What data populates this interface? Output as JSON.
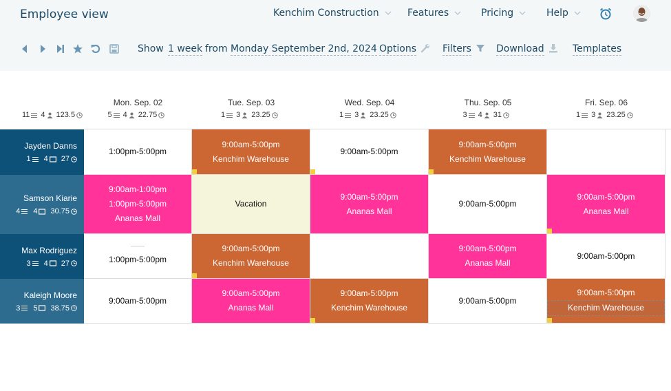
{
  "header": {
    "title": "Employee view",
    "nav": [
      {
        "label": "Kenchim Construction"
      },
      {
        "label": "Features"
      },
      {
        "label": "Pricing"
      },
      {
        "label": "Help"
      }
    ]
  },
  "toolbar": {
    "icons": [
      "previous-icon",
      "next-icon",
      "skip-to-end-icon",
      "star-icon",
      "undo-icon",
      "save-icon"
    ],
    "show_label": "Show",
    "period": "1 week",
    "from_label": "from",
    "start_date": "Monday September 2nd, 2024",
    "options": "Options",
    "filters": "Filters",
    "download": "Download",
    "templates": "Templates"
  },
  "colors": {
    "shift_orange": "#cc6633",
    "shift_pink": "#ff3399",
    "vacation": "#f5f5dc",
    "employee_dark": "#0d5078",
    "employee_light": "#2e6c8f",
    "marker": "#f2d03b"
  },
  "totals": {
    "shifts": "11",
    "employees": "4",
    "hours": "123.5"
  },
  "days": [
    {
      "label": "Mon. Sep. 02",
      "shifts": "5",
      "employees": "4",
      "hours": "22.75"
    },
    {
      "label": "Tue. Sep. 03",
      "shifts": "1",
      "employees": "3",
      "hours": "23.25"
    },
    {
      "label": "Wed. Sep. 04",
      "shifts": "1",
      "employees": "3",
      "hours": "23.25"
    },
    {
      "label": "Thu. Sep. 05",
      "shifts": "3",
      "employees": "4",
      "hours": "31"
    },
    {
      "label": "Fri. Sep. 06",
      "shifts": "1",
      "employees": "3",
      "hours": "23.25"
    }
  ],
  "employees": [
    {
      "name": "Jayden Danns",
      "shifts": "1",
      "days": "4",
      "hours": "27",
      "cells": [
        {
          "type": "white",
          "lines": [
            "1:00pm-5:00pm"
          ]
        },
        {
          "type": "orange",
          "lines": [
            "9:00am-5:00pm",
            "Kenchim Warehouse"
          ],
          "marker": true
        },
        {
          "type": "white",
          "lines": [
            "9:00am-5:00pm"
          ],
          "marker": true
        },
        {
          "type": "orange",
          "lines": [
            "9:00am-5:00pm",
            "Kenchim Warehouse"
          ],
          "marker": true
        },
        {
          "type": "white",
          "lines": []
        }
      ]
    },
    {
      "name": "Samson Kiarie",
      "shifts": "4",
      "days": "4",
      "hours": "30.75",
      "cells": [
        {
          "type": "pink",
          "lines": [
            "9:00am-1:00pm",
            "1:00pm-5:00pm",
            "Ananas Mall"
          ]
        },
        {
          "type": "vacation",
          "lines": [
            "Vacation"
          ]
        },
        {
          "type": "pink",
          "lines": [
            "9:00am-5:00pm",
            "Ananas Mall"
          ]
        },
        {
          "type": "white",
          "lines": [
            "9:00am-5:00pm"
          ]
        },
        {
          "type": "pink",
          "lines": [
            "9:00am-5:00pm",
            "Ananas Mall"
          ],
          "marker": true
        }
      ]
    },
    {
      "name": "Max Rodriguez",
      "shifts": "3",
      "days": "4",
      "hours": "27",
      "cells": [
        {
          "type": "white",
          "lines": [
            "1:00pm-5:00pm"
          ],
          "separator": true
        },
        {
          "type": "orange",
          "lines": [
            "9:00am-5:00pm",
            "Kenchim Warehouse"
          ],
          "marker": true
        },
        {
          "type": "white",
          "lines": []
        },
        {
          "type": "pink",
          "lines": [
            "9:00am-5:00pm",
            "Ananas Mall"
          ]
        },
        {
          "type": "white",
          "lines": [
            "9:00am-5:00pm"
          ]
        }
      ]
    },
    {
      "name": "Kaleigh Moore",
      "shifts": "3",
      "days": "5",
      "hours": "38.75",
      "cells": [
        {
          "type": "white",
          "lines": [
            "9:00am-5:00pm"
          ]
        },
        {
          "type": "pink",
          "lines": [
            "9:00am-5:00pm",
            "Ananas Mall"
          ]
        },
        {
          "type": "orange",
          "lines": [
            "9:00am-5:00pm",
            "Kenchim Warehouse"
          ],
          "marker": true
        },
        {
          "type": "white",
          "lines": [
            "9:00am-5:00pm"
          ]
        },
        {
          "type": "orange",
          "lines": [
            "9:00am-5:00pm",
            "Kenchim Warehouse"
          ],
          "marker": true,
          "selected_location": true
        }
      ]
    }
  ]
}
